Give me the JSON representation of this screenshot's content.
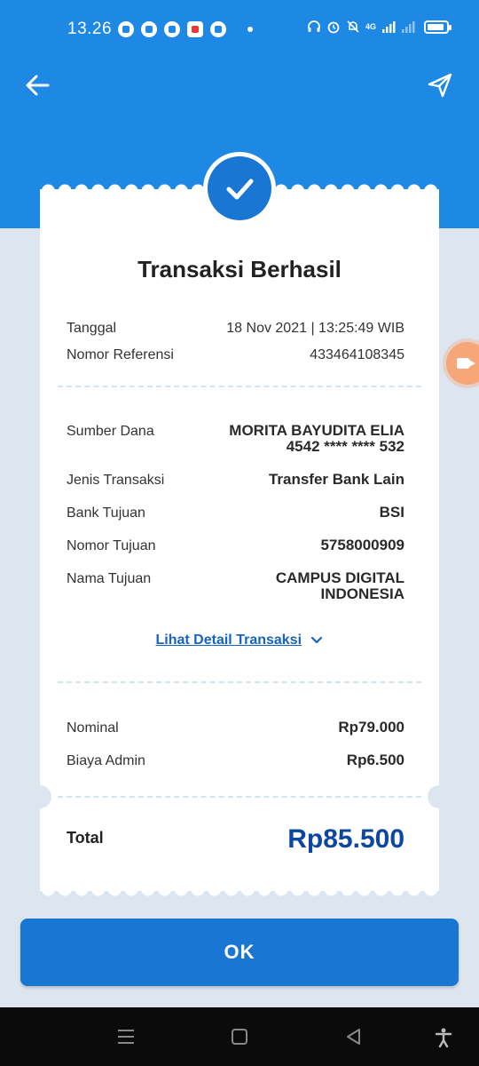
{
  "status_bar": {
    "time": "13.26",
    "left_icons": [
      "whatsapp-icon",
      "messenger-icon",
      "line-icon",
      "red-app-icon",
      "facebook-icon",
      "more-dot-icon"
    ],
    "right_icons": [
      "headset-icon",
      "alarm-icon",
      "mute-icon",
      "signal-4g-icon",
      "signal-icon",
      "battery-icon"
    ],
    "network_label": "4G"
  },
  "header": {
    "back_icon": "arrow-left-icon",
    "share_icon": "send-icon",
    "color": "#1e88e5"
  },
  "receipt": {
    "title": "Transaksi Berhasil",
    "tanggal_label": "Tanggal",
    "tanggal_value": "18 Nov 2021 | 13:25:49 WIB",
    "referensi_label": "Nomor Referensi",
    "referensi_value": "433464108345",
    "sumber_dana_label": "Sumber Dana",
    "sumber_dana_name": "MORITA BAYUDITA ELIA",
    "sumber_dana_card": "4542 **** **** 532",
    "jenis_label": "Jenis Transaksi",
    "jenis_value": "Transfer Bank Lain",
    "bank_label": "Bank Tujuan",
    "bank_value": "BSI",
    "nomor_tujuan_label": "Nomor Tujuan",
    "nomor_tujuan_value": "5758000909",
    "nama_tujuan_label": "Nama Tujuan",
    "nama_tujuan_line1": "CAMPUS DIGITAL",
    "nama_tujuan_line2": "INDONESIA",
    "detail_link": "Lihat Detail Transaksi",
    "nominal_label": "Nominal",
    "nominal_value": "Rp79.000",
    "admin_label": "Biaya Admin",
    "admin_value": "Rp6.500",
    "total_label": "Total",
    "total_value": "Rp85.500"
  },
  "ok_button": "OK",
  "colors": {
    "primary": "#1e88e5",
    "button": "#1976d2",
    "total": "#0d47a1",
    "background": "#dde6ef"
  }
}
